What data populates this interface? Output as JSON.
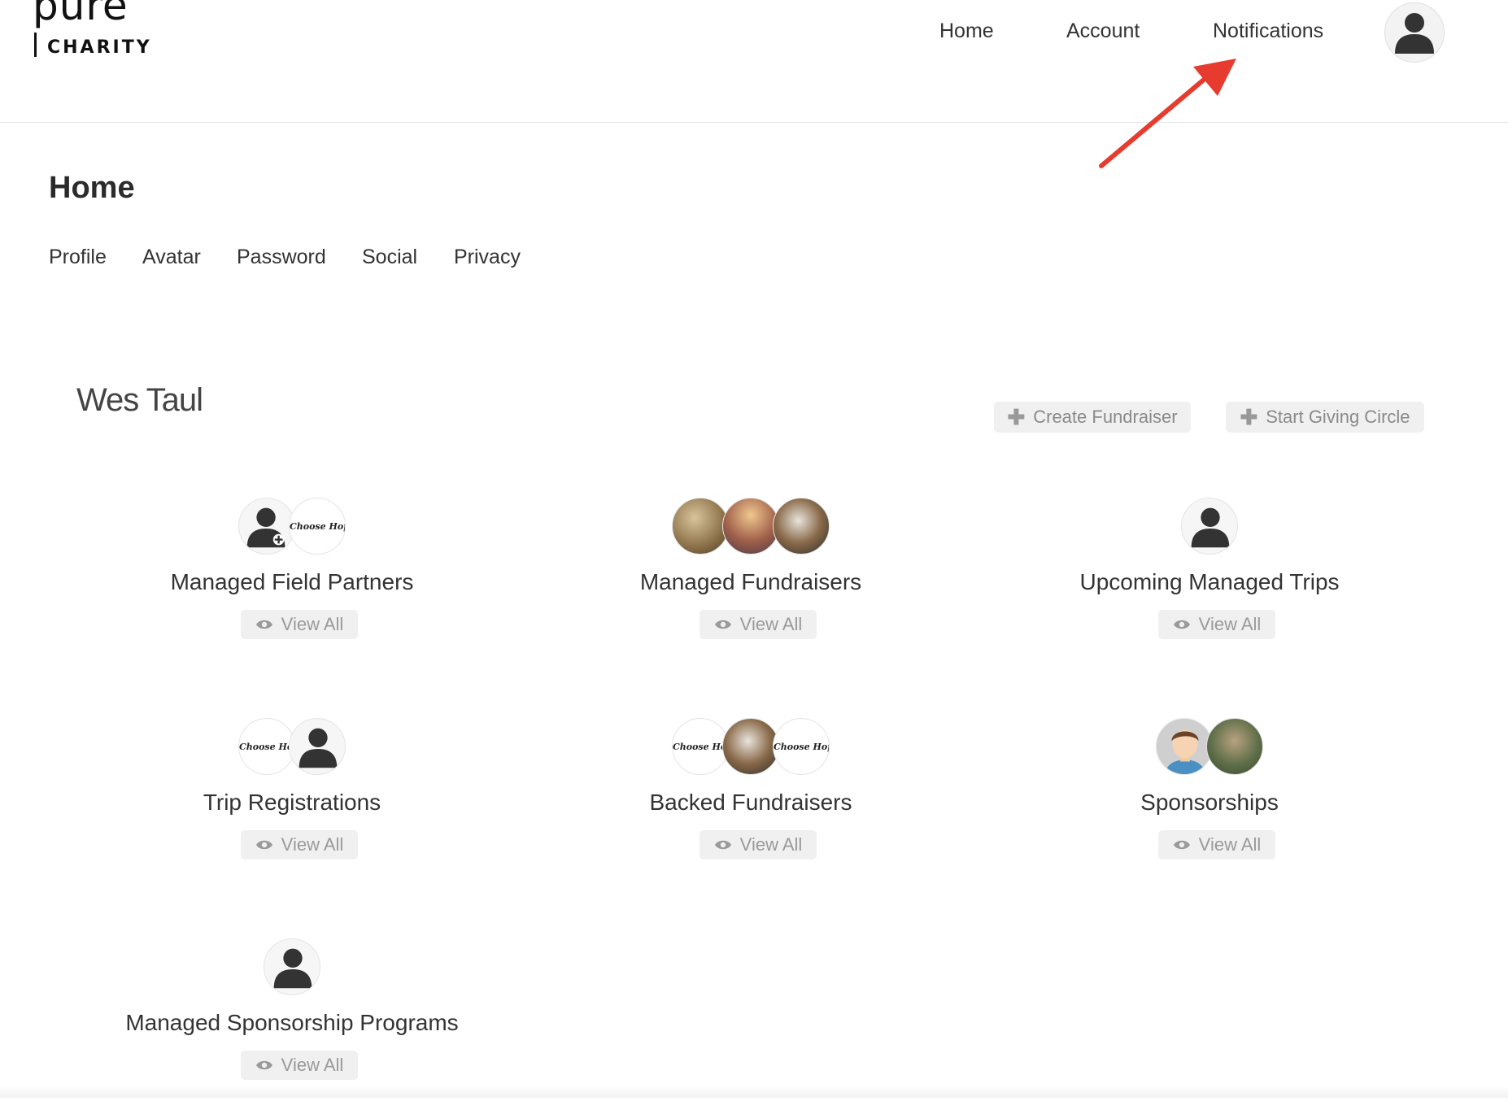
{
  "header": {
    "logo_top": "pure",
    "logo_bottom": "CHARITY",
    "nav": [
      "Home",
      "Account",
      "Notifications"
    ]
  },
  "page": {
    "title": "Home",
    "subnav": [
      "Profile",
      "Avatar",
      "Password",
      "Social",
      "Privacy"
    ]
  },
  "user": {
    "name": "Wes Taul"
  },
  "actions": {
    "create_fundraiser": "Create Fundraiser",
    "start_giving_circle": "Start Giving Circle"
  },
  "cards": [
    {
      "title": "Managed Field Partners",
      "button": "View All",
      "avatar_label": "Choose Hope"
    },
    {
      "title": "Managed Fundraisers",
      "button": "View All"
    },
    {
      "title": "Upcoming Managed Trips",
      "button": "View All"
    },
    {
      "title": "Trip Registrations",
      "button": "View All",
      "avatar_label": "Choose Hop"
    },
    {
      "title": "Backed Fundraisers",
      "button": "View All",
      "avatar_label": "Choose Hop",
      "avatar_label_2": "Choose Hope"
    },
    {
      "title": "Sponsorships",
      "button": "View All"
    },
    {
      "title": "Managed Sponsorship Programs",
      "button": "View All"
    }
  ],
  "colors": {
    "annotation_arrow": "#e63b2e",
    "button_bg": "#f0f0f0",
    "button_text": "#9a9a9a"
  }
}
